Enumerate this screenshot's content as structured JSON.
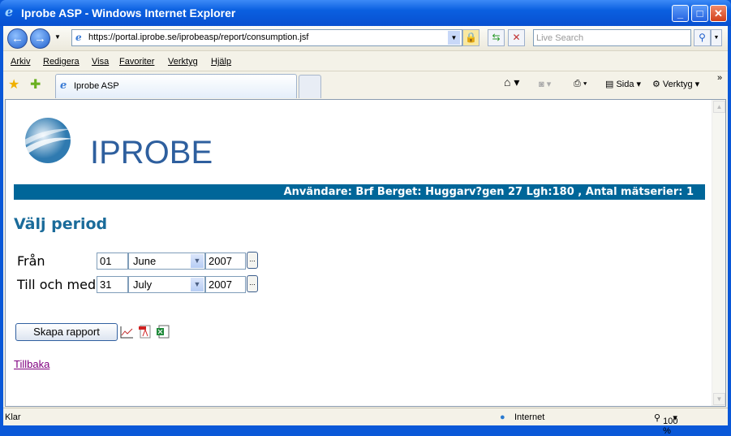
{
  "window": {
    "title": "Iprobe ASP - Windows Internet Explorer"
  },
  "address": {
    "url": "https://portal.iprobe.se/iprobeasp/report/consumption.jsf",
    "search_placeholder": "Live Search"
  },
  "menu": [
    "Arkiv",
    "Redigera",
    "Visa",
    "Favoriter",
    "Verktyg",
    "Hjälp"
  ],
  "tab": {
    "label": "Iprobe ASP"
  },
  "toolbar": {
    "page_label": "Sida",
    "tools_label": "Verktyg"
  },
  "page": {
    "logo_text": "IPROBE",
    "user_info": "Användare: Brf Berget: Huggarv?gen 27 Lgh:180 , Antal mätserier: 1",
    "heading": "Välj period",
    "from": {
      "label": "Från",
      "day": "01",
      "month": "June",
      "year": "2007"
    },
    "to": {
      "label": "Till och med",
      "day": "31",
      "month": "July",
      "year": "2007"
    },
    "picker_label": "...",
    "create_report": "Skapa rapport",
    "back_link": "Tillbaka"
  },
  "status": {
    "text": "Klar",
    "zone": "Internet",
    "zoom": "100 %"
  },
  "colors": {
    "header_bar": "#006699",
    "heading": "#1a6b9a",
    "link": "#800080"
  }
}
